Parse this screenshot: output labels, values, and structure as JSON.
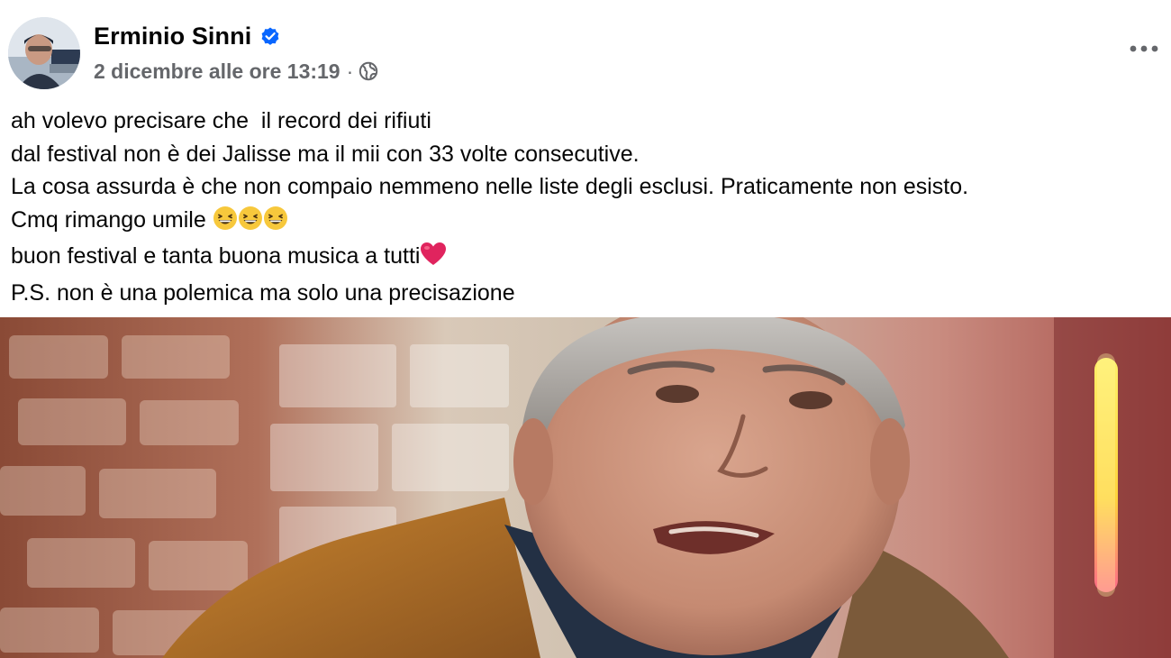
{
  "post": {
    "author": {
      "name": "Erminio Sinni",
      "verified": true,
      "avatar_icon": "profile-photo"
    },
    "timestamp": "2 dicembre alle ore 13:19",
    "meta_separator": "·",
    "audience_icon": "globe-icon",
    "more_icon": "more-horizontal-icon",
    "text_lines": [
      "ah volevo precisare che  il record dei rifiuti",
      "dal festival non è dei Jalisse ma il mii con 33 volte consecutive.",
      "La cosa assurda è che non compaio nemmeno nelle liste degli esclusi. Praticamente non esisto.",
      "Cmq rimango umile ",
      "buon festival e tanta buona musica a tutti",
      "P.S. non è una polemica ma solo una precisazione"
    ],
    "emoji": {
      "grin": "grinning-squinting-face",
      "heart": "red-heart"
    },
    "photo_subject": "man-speaking-photo"
  },
  "colors": {
    "text": "#050505",
    "secondary_text": "#65676b",
    "verified_blue": "#0866ff",
    "heart_red": "#e0245e",
    "emoji_yellow": "#f7c83c"
  }
}
